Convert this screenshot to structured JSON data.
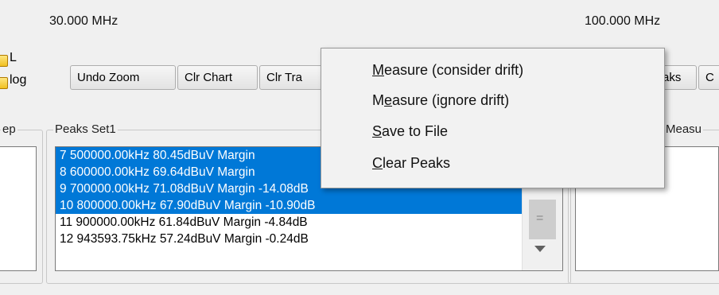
{
  "header": {
    "freq_start": "30.000 MHz",
    "freq_stop": "100.000 MHz"
  },
  "options": {
    "checkbox_l_label": "L",
    "checkbox_log_label": "log"
  },
  "toolbar": {
    "undo_zoom": "Undo Zoom",
    "clr_chart": "Clr Chart",
    "clr_tra": "Clr Tra",
    "peaks_partial": "aks",
    "next_partial": "C"
  },
  "groups": {
    "sweep_partial": "ep",
    "peaks_set1": "Peaks Set1",
    "measure_partial": "Measu"
  },
  "peaks": {
    "rows": [
      "7  500000.00kHz 80.45dBuV Margin",
      "8  600000.00kHz 69.64dBuV Margin",
      "9  700000.00kHz 71.08dBuV Margin -14.08dB",
      "10  800000.00kHz 67.90dBuV Margin -10.90dB",
      "11  900000.00kHz 61.84dBuV Margin -4.84dB",
      "12  943593.75kHz 57.24dBuV Margin -0.24dB"
    ],
    "scroll_grip": "="
  },
  "context_menu": {
    "measure_consider": {
      "ul": "M",
      "rest": "easure (consider drift)"
    },
    "measure_ignore": {
      "pre": "M",
      "ul": "e",
      "rest": "asure (ignore drift)"
    },
    "save_to_file": {
      "ul": "S",
      "rest": "ave to File"
    },
    "clear_peaks": {
      "ul": "C",
      "rest": "lear Peaks"
    }
  },
  "colors": {
    "selection": "#0078d7",
    "menu_bg": "#f2f2f2",
    "window_bg": "#f0f0f0"
  }
}
